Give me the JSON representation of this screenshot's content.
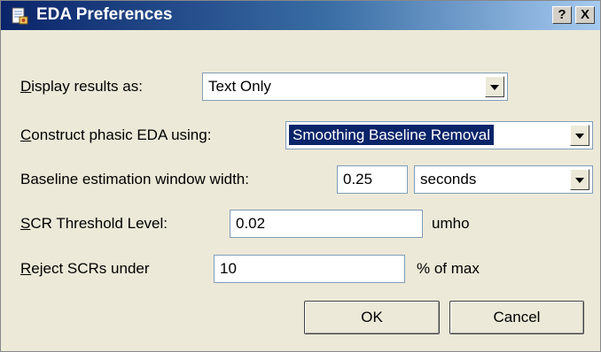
{
  "window": {
    "title": "EDA Preferences",
    "help_label": "?",
    "close_label": "X"
  },
  "display_results": {
    "mnemonic": "D",
    "label_rest": "isplay results as:",
    "value": "Text Only"
  },
  "construct_phasic": {
    "mnemonic": "C",
    "label_rest": "onstruct phasic EDA using:",
    "value": "Smoothing Baseline Removal"
  },
  "baseline_window": {
    "label": "Baseline estimation window width:",
    "value": "0.25",
    "unit_value": "seconds"
  },
  "scr_threshold": {
    "mnemonic": "S",
    "label_rest": "CR Threshold Level:",
    "value": "0.02",
    "unit": "umho"
  },
  "reject_scrs": {
    "mnemonic": "R",
    "label_rest": "eject SCRs under",
    "value": "10",
    "unit": "% of max"
  },
  "buttons": {
    "ok": "OK",
    "cancel": "Cancel"
  },
  "icons": {
    "app": "document-icon",
    "help": "help-icon",
    "close": "close-icon",
    "dropdown": "chevron-down-icon"
  }
}
